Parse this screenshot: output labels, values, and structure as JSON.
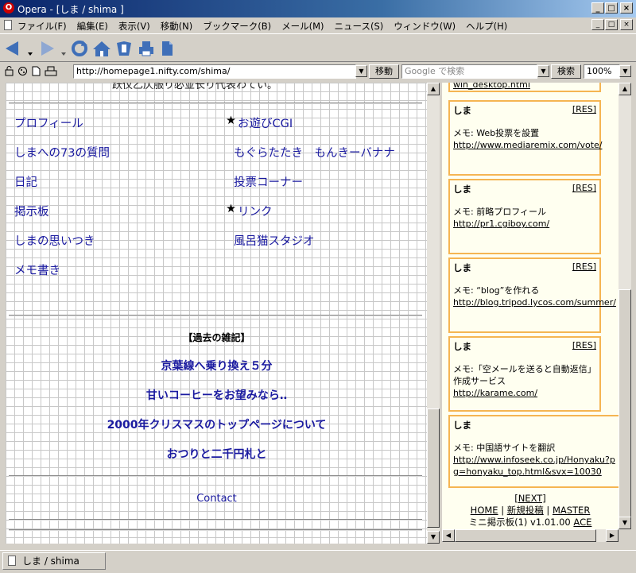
{
  "window": {
    "title": "Opera - [しま / shima ]",
    "logo_letter": "O",
    "min_glyph": "_",
    "max_glyph": "□",
    "close_glyph": "×"
  },
  "menu": [
    "ファイル(F)",
    "編集(E)",
    "表示(V)",
    "移動(N)",
    "ブックマーク(B)",
    "メール(M)",
    "ニュース(S)",
    "ウィンドウ(W)",
    "ヘルプ(H)"
  ],
  "address": {
    "url": "http://homepage1.nifty.com/shima/",
    "go_label": "移動",
    "search_placeholder": "Google で検索",
    "search_label": "検索",
    "zoom": "100%"
  },
  "main": {
    "top_cut_text": "跃仪乙仄服り必並长り代表わてい。",
    "left_links": [
      "プロフィール",
      "しまへの73の質問",
      "日記",
      "掲示板",
      "しまの思いつき",
      "メモ書き"
    ],
    "right_links": [
      {
        "star": "★",
        "text": "お遊びCGI"
      },
      {
        "star": "",
        "text": "もぐらたたき　もんきーバナナ"
      },
      {
        "star": "",
        "text": "投票コーナー"
      },
      {
        "star": "★",
        "text": "リンク"
      },
      {
        "star": "",
        "text": "風呂猫スタジオ"
      }
    ],
    "past_heading": "【過去の雑記】",
    "past_links": [
      "京葉線へ乗り換え５分",
      "甘いコーヒーをお望みなら‥",
      "2000年クリスマスのトップページについて",
      "おつりと二千円札と"
    ],
    "contact": "Contact"
  },
  "board": {
    "top_cut_url": "win_desktop.html",
    "posts": [
      {
        "name": "しま",
        "res": "[RES]",
        "memo": "メモ: Web投票を設置",
        "url": "http://www.mediaremix.com/vote/"
      },
      {
        "name": "しま",
        "res": "[RES]",
        "memo": "メモ: 前略プロフィール",
        "url": "http://pr1.cgiboy.com/"
      },
      {
        "name": "しま",
        "res": "[RES]",
        "memo": "メモ: “blog”を作れる",
        "url": "http://blog.tripod.lycos.com/summer/"
      },
      {
        "name": "しま",
        "res": "[RES]",
        "memo": "メモ:「空メールを送ると自動返信」作成サービス",
        "url": "http://karame.com/"
      },
      {
        "name": "しま",
        "res": "",
        "memo": "メモ: 中国語サイトを翻訳",
        "url": "http://www.infoseek.co.jp/Honyaku?pg=honyaku_top.html&svx=10030"
      }
    ],
    "next": "[NEXT]",
    "home": "HOME",
    "new_post": "新規投稿",
    "master": "MASTER",
    "sep": " | ",
    "footer_text": "ミニ掲示板(1) v1.01.00",
    "ace": "ACE"
  },
  "status": {
    "tab_title": "しま / shima"
  },
  "colors": {
    "link": "#1a1aa0",
    "post_border": "#f5b552",
    "board_bg": "#fffff0",
    "grid": "#c8c8c8"
  }
}
